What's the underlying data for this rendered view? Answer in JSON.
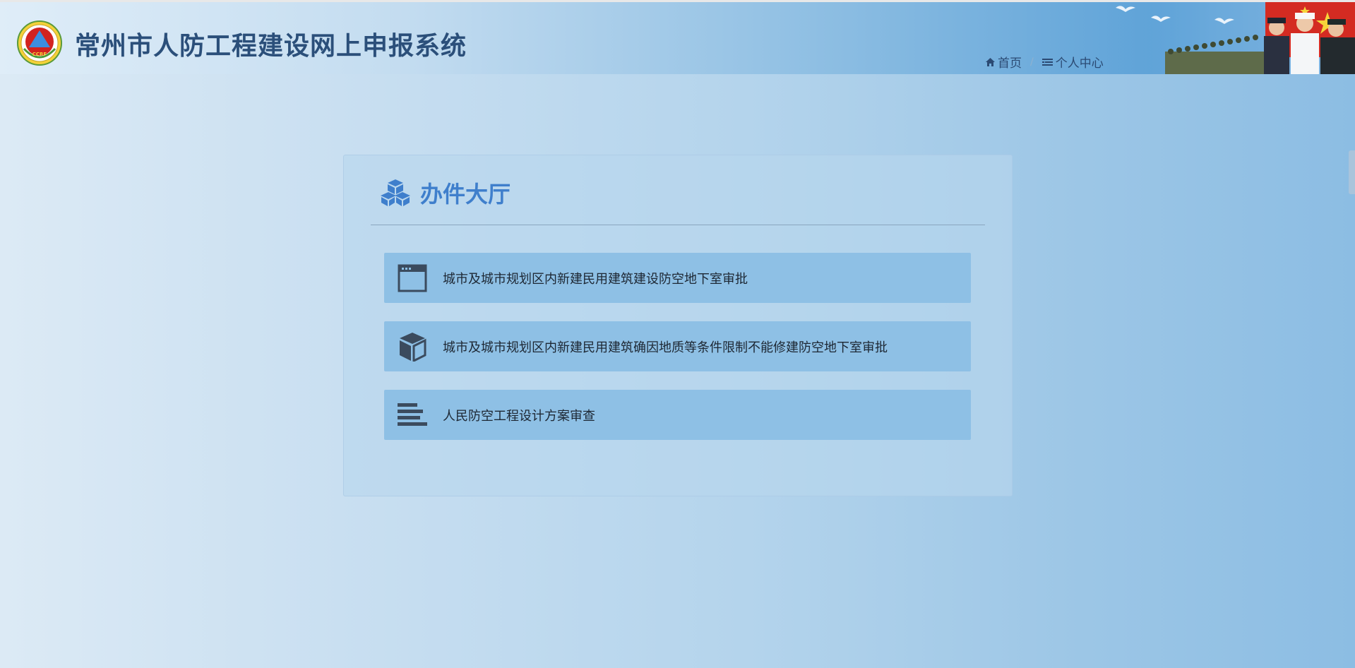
{
  "header": {
    "title": "常州市人防工程建设网上申报系统",
    "logo_text": "CCRF",
    "nav": [
      {
        "label": "首页",
        "icon": "home-icon"
      },
      {
        "label": "个人中心",
        "icon": "list-icon"
      }
    ],
    "nav_separator": "/"
  },
  "panel": {
    "title": "办件大厅",
    "title_icon": "cubes-icon",
    "items": [
      {
        "label": "城市及城市规划区内新建民用建筑建设防空地下室审批",
        "icon": "browser-window-icon"
      },
      {
        "label": "城市及城市规划区内新建民用建筑确因地质等条件限制不能修建防空地下室审批",
        "icon": "cube-icon"
      },
      {
        "label": "人民防空工程设计方案审查",
        "icon": "bar-list-icon"
      }
    ]
  },
  "colors": {
    "title": "#2b4f7a",
    "accent": "#3f7fcc",
    "item_bg": "#8ec0e5",
    "icon": "#3b4b5e"
  }
}
